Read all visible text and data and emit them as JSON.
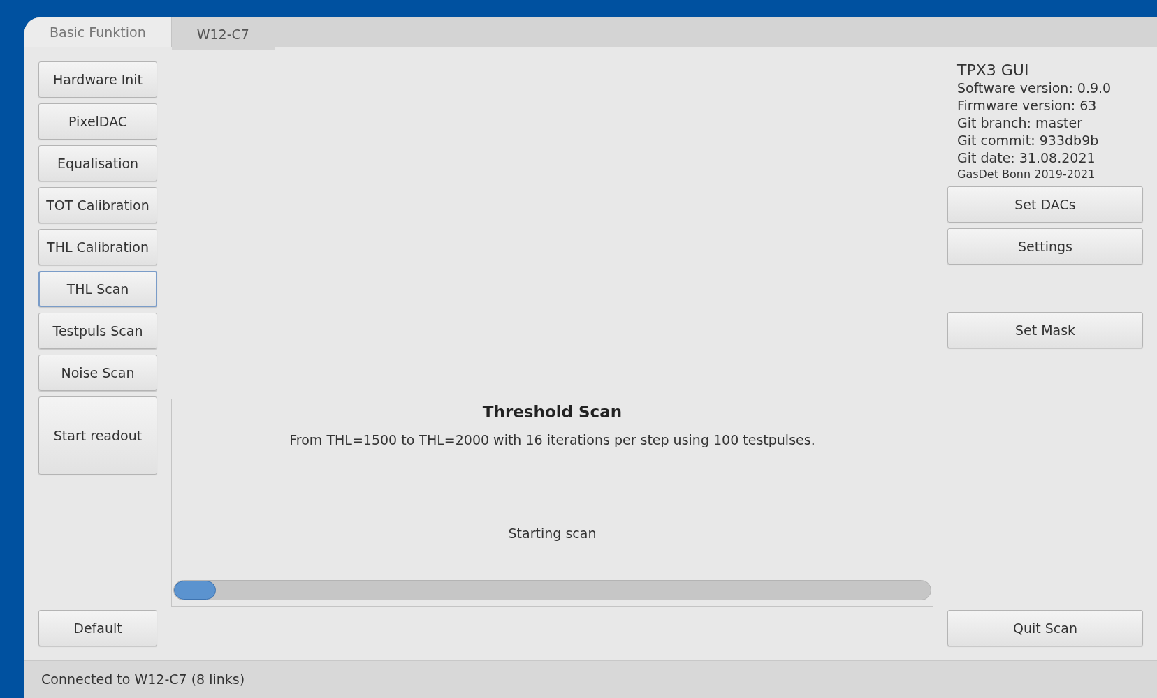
{
  "tabs": [
    {
      "label": "Basic Funktion",
      "selected": true
    },
    {
      "label": "W12-C7",
      "selected": false
    }
  ],
  "left_buttons": [
    {
      "label": "Hardware Init",
      "selected": false
    },
    {
      "label": "PixelDAC",
      "selected": false
    },
    {
      "label": "Equalisation",
      "selected": false
    },
    {
      "label": "TOT Calibration",
      "selected": false
    },
    {
      "label": "THL Calibration",
      "selected": false
    },
    {
      "label": "THL Scan",
      "selected": true
    },
    {
      "label": "Testpuls Scan",
      "selected": false
    },
    {
      "label": "Noise Scan",
      "selected": false
    },
    {
      "label": "Start readout",
      "selected": false
    }
  ],
  "default_button": "Default",
  "scan_panel": {
    "title": "Threshold Scan",
    "description": "From THL=1500 to THL=2000 with 16 iterations per step using 100 testpulses.",
    "status": "Starting scan",
    "level": 0.055
  },
  "info": {
    "title": "TPX3 GUI",
    "lines": [
      "Software version: 0.9.0",
      "Firmware version: 63",
      "Git branch: master",
      "Git commit: 933db9b",
      "Git date: 31.08.2021"
    ],
    "credit": "GasDet Bonn 2019-2021"
  },
  "right_buttons_top": [
    "Set DACs",
    "Settings"
  ],
  "right_buttons_middle": [
    "Set Mask"
  ],
  "quit_button": "Quit Scan",
  "status_bar": "Connected to W12-C7 (8 links)"
}
